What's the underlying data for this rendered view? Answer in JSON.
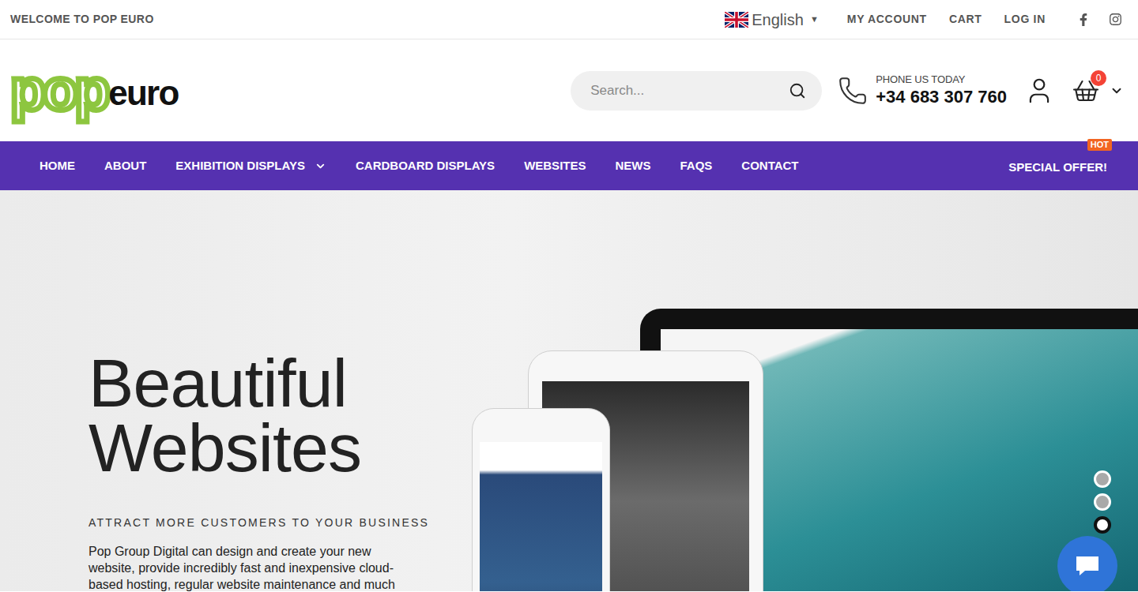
{
  "topbar": {
    "welcome": "WELCOME TO POP EURO",
    "language": "English",
    "language_caret": "▼",
    "links": [
      "MY ACCOUNT",
      "CART",
      "LOG IN"
    ]
  },
  "logo": {
    "pop": "pop",
    "euro": "euro"
  },
  "search": {
    "placeholder": "Search..."
  },
  "phone": {
    "label": "PHONE US TODAY",
    "number": "+34 683 307 760"
  },
  "cart": {
    "count": "0"
  },
  "nav": {
    "items": [
      {
        "label": "HOME",
        "dropdown": false
      },
      {
        "label": "ABOUT",
        "dropdown": false
      },
      {
        "label": "EXHIBITION DISPLAYS",
        "dropdown": true
      },
      {
        "label": "CARDBOARD DISPLAYS",
        "dropdown": false
      },
      {
        "label": "WEBSITES",
        "dropdown": false
      },
      {
        "label": "NEWS",
        "dropdown": false
      },
      {
        "label": "FAQS",
        "dropdown": false
      },
      {
        "label": "CONTACT",
        "dropdown": false
      }
    ],
    "special": {
      "label": "SPECIAL OFFER!",
      "badge": "HOT"
    }
  },
  "hero": {
    "title": [
      "Beautiful",
      "Websites"
    ],
    "subtitle": "ATTRACT MORE CUSTOMERS TO YOUR BUSINESS",
    "body": "Pop Group Digital can design and create your new website, provide incredibly fast and inexpensive cloud-based hosting, regular website maintenance and much"
  },
  "slider": {
    "dots": [
      {
        "selected": false
      },
      {
        "selected": false
      },
      {
        "selected": true
      }
    ]
  }
}
